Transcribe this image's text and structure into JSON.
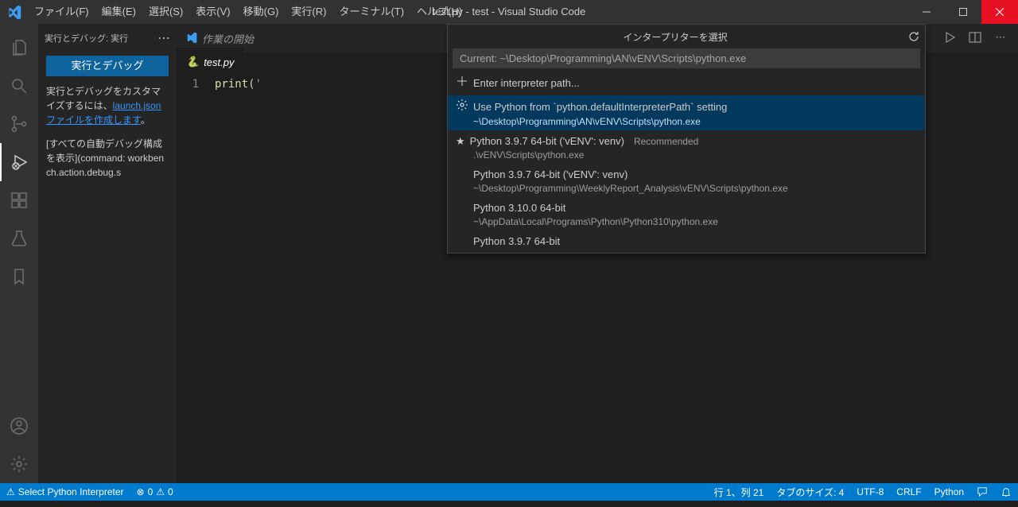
{
  "window": {
    "title": "test.py - test - Visual Studio Code"
  },
  "menu": [
    "ファイル(F)",
    "編集(E)",
    "選択(S)",
    "表示(V)",
    "移動(G)",
    "実行(R)",
    "ターミナル(T)",
    "ヘルプ(H)"
  ],
  "panel": {
    "title": "実行とデバッグ: 実行",
    "run_label": "実行とデバッグ",
    "para1_a": "実行とデバッグをカスタマイズするには、",
    "para1_link": "launch.json ファイルを作成します",
    "para1_b": "。",
    "para2": "[すべての自動デバッグ構成を表示](command: workbench.action.debug.s"
  },
  "tabs": {
    "welcome": "作業の開始",
    "file": "test.py"
  },
  "editor": {
    "line_no": "1",
    "code_fn": "print",
    "code_open": "(",
    "code_str": "'"
  },
  "quickInput": {
    "title": "インタープリターを選択",
    "current": "Current: ~\\Desktop\\Programming\\AN\\vENV\\Scripts\\python.exe",
    "enter_path": "Enter interpreter path...",
    "row_selected_main": "Use Python from `python.defaultInterpreterPath` setting",
    "row_selected_sub": "~\\Desktop\\Programming\\AN\\vENV\\Scripts\\python.exe",
    "row2_main": "Python 3.9.7 64-bit ('vENV': venv)",
    "row2_reco": "Recommended",
    "row2_sub": ".\\vENV\\Scripts\\python.exe",
    "row3_main": "Python 3.9.7 64-bit ('vENV': venv)",
    "row3_sub": "~\\Desktop\\Programming\\WeeklyReport_Analysis\\vENV\\Scripts\\python.exe",
    "row4_main": "Python 3.10.0 64-bit",
    "row4_sub": "~\\AppData\\Local\\Programs\\Python\\Python310\\python.exe",
    "row5_main": "Python 3.9.7 64-bit"
  },
  "status": {
    "left_warn": "Select Python Interpreter",
    "errors": "0",
    "warnings": "0",
    "cursor": "行 1、列 21",
    "tab": "タブのサイズ: 4",
    "encoding": "UTF-8",
    "eol": "CRLF",
    "lang": "Python"
  }
}
